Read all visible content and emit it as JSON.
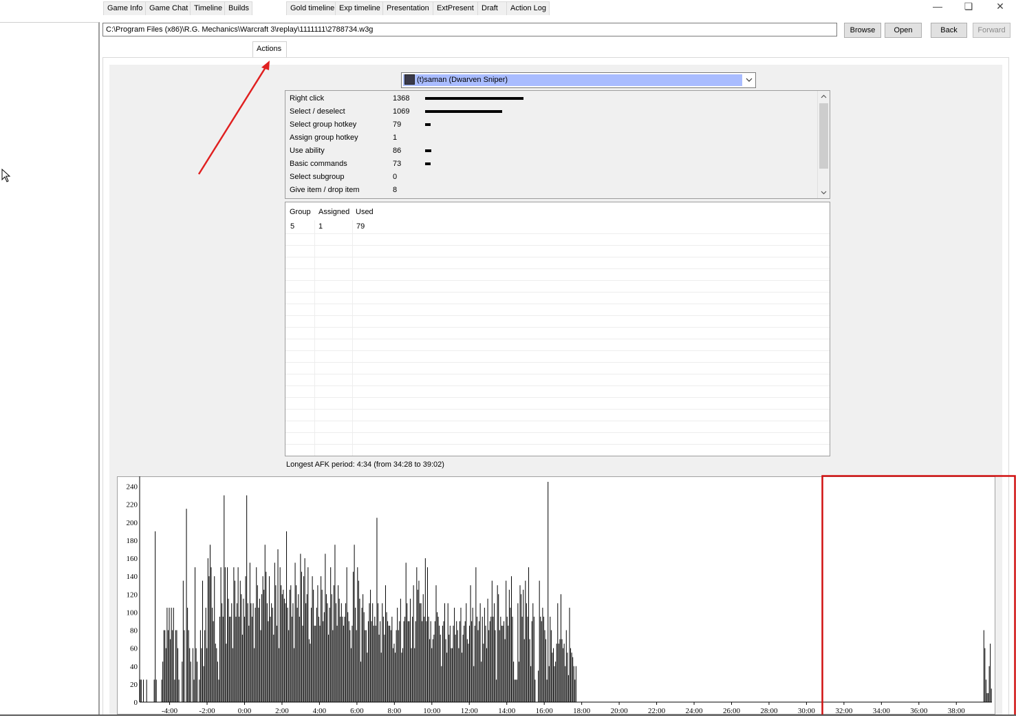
{
  "window": {
    "controls": [
      "minimize",
      "restore",
      "close"
    ]
  },
  "toolbar": {
    "path_value": "C:\\Program Files (x86)\\R.G. Mechanics\\Warcraft 3\\replay\\1111111\\2788734.w3g",
    "browse_label": "Browse",
    "open_label": "Open",
    "back_label": "Back",
    "forward_label": "Forward"
  },
  "tabs": [
    {
      "label": "Game Info"
    },
    {
      "label": "Game Chat"
    },
    {
      "label": "Timeline"
    },
    {
      "label": "Builds"
    },
    {
      "label": "Actions",
      "active": true
    },
    {
      "label": "Gold timeline"
    },
    {
      "label": "Exp timeline"
    },
    {
      "label": "Presentation"
    },
    {
      "label": "ExtPresent"
    },
    {
      "label": "Draft"
    },
    {
      "label": "Action Log"
    }
  ],
  "player_select": {
    "selected": "(t)saman (Dwarven Sniper)"
  },
  "actions": [
    {
      "name": "Right click",
      "count": 1368
    },
    {
      "name": "Select / deselect",
      "count": 1069
    },
    {
      "name": "Select group hotkey",
      "count": 79
    },
    {
      "name": "Assign group hotkey",
      "count": 1
    },
    {
      "name": "Use ability",
      "count": 86
    },
    {
      "name": "Basic commands",
      "count": 73
    },
    {
      "name": "Select subgroup",
      "count": 0
    },
    {
      "name": "Give item / drop item",
      "count": 8
    }
  ],
  "groups": {
    "headers": [
      "Group",
      "Assigned",
      "Used"
    ],
    "rows": [
      [
        "5",
        "1",
        "79"
      ]
    ]
  },
  "afk": {
    "text": "Longest AFK period: 4:34 (from 34:28 to 39:02)"
  },
  "chart_data": {
    "type": "bar",
    "title": "",
    "xlabel": "",
    "ylabel": "",
    "ylim": [
      0,
      245
    ],
    "yticks": [
      0,
      20,
      40,
      60,
      80,
      100,
      120,
      140,
      160,
      180,
      200,
      220,
      240
    ],
    "xticks": [
      "-4:00",
      "-2:00",
      "0:00",
      "2:00",
      "4:00",
      "6:00",
      "8:00",
      "10:00",
      "12:00",
      "14:00",
      "16:00",
      "18:00",
      "20:00",
      "22:00",
      "24:00",
      "26:00",
      "28:00",
      "30:00",
      "32:00",
      "34:00",
      "36:00",
      "38:00"
    ],
    "x_range_minutes": [
      -5.6,
      39.9
    ],
    "bar_color": "#000000",
    "series": [
      {
        "values": [
          25,
          25,
          0,
          25,
          0,
          0,
          25,
          0,
          0,
          0,
          0,
          0,
          0,
          25,
          190,
          25,
          0,
          0,
          0,
          0,
          25,
          45,
          80,
          80,
          60,
          105,
          80,
          105,
          70,
          105,
          80,
          105,
          25,
          80,
          80,
          60,
          25,
          0,
          0,
          45,
          135,
          80,
          0,
          215,
          105,
          80,
          60,
          45,
          0,
          60,
          25,
          150,
          60,
          45,
          0,
          25,
          80,
          60,
          135,
          40,
          80,
          105,
          60,
          160,
          140,
          175,
          150,
          105,
          90,
          140,
          65,
          60,
          45,
          25,
          95,
          150,
          110,
          95,
          230,
          150,
          65,
          150,
          115,
          95,
          95,
          110,
          60,
          150,
          135,
          95,
          110,
          150,
          95,
          135,
          120,
          75,
          115,
          95,
          140,
          230,
          110,
          85,
          155,
          110,
          95,
          110,
          60,
          105,
          150,
          130,
          105,
          115,
          80,
          120,
          140,
          125,
          175,
          145,
          110,
          90,
          140,
          95,
          110,
          105,
          75,
          155,
          130,
          85,
          170,
          60,
          150,
          130,
          120,
          125,
          115,
          110,
          190,
          105,
          80,
          125,
          130,
          95,
          110,
          60,
          155,
          130,
          105,
          120,
          95,
          165,
          145,
          85,
          140,
          160,
          110,
          120,
          150,
          70,
          65,
          105,
          140,
          125,
          85,
          85,
          105,
          130,
          95,
          85,
          140,
          125,
          90,
          100,
          165,
          120,
          110,
          75,
          105,
          150,
          120,
          80,
          130,
          175,
          110,
          85,
          130,
          115,
          95,
          110,
          95,
          85,
          95,
          110,
          150,
          100,
          90,
          80,
          60,
          85,
          145,
          175,
          105,
          80,
          150,
          135,
          115,
          45,
          105,
          120,
          100,
          80,
          80,
          55,
          90,
          110,
          125,
          90,
          110,
          85,
          95,
          85,
          205,
          110,
          75,
          90,
          55,
          110,
          95,
          75,
          130,
          100,
          90,
          85,
          85,
          80,
          95,
          60,
          65,
          55,
          80,
          105,
          80,
          90,
          115,
          55,
          60,
          90,
          95,
          155,
          110,
          90,
          90,
          115,
          60,
          95,
          130,
          60,
          90,
          150,
          125,
          135,
          110,
          110,
          90,
          120,
          95,
          160,
          90,
          150,
          95,
          70,
          90,
          60,
          70,
          75,
          90,
          130,
          100,
          95,
          85,
          75,
          40,
          85,
          90,
          110,
          70,
          55,
          110,
          75,
          85,
          60,
          60,
          85,
          105,
          75,
          90,
          80,
          60,
          90,
          105,
          55,
          75,
          85,
          90,
          110,
          70,
          65,
          85,
          130,
          90,
          105,
          40,
          85,
          150,
          95,
          80,
          90,
          110,
          45,
          95,
          65,
          105,
          85,
          60,
          115,
          80,
          90,
          95,
          135,
          95,
          110,
          80,
          25,
          130,
          120,
          80,
          95,
          85,
          85,
          90,
          70,
          135,
          95,
          85,
          125,
          105,
          140,
          95,
          45,
          25,
          25,
          25,
          110,
          45,
          130,
          120,
          95,
          125,
          70,
          135,
          110,
          95,
          150,
          70,
          40,
          90,
          110,
          95,
          25,
          0,
          0,
          35,
          135,
          95,
          90,
          105,
          95,
          80,
          70,
          25,
          245,
          40,
          95,
          80,
          55,
          60,
          40,
          45,
          65,
          110,
          65,
          70,
          120,
          70,
          60,
          65,
          40,
          80,
          55,
          30,
          105,
          60,
          55,
          50,
          40,
          25,
          40,
          0,
          0,
          0,
          0,
          0,
          0,
          0,
          0,
          0,
          0,
          0,
          0,
          0,
          0,
          0,
          0,
          0,
          0,
          0,
          0,
          0,
          0,
          0,
          0,
          0,
          0,
          0,
          0,
          0,
          0,
          0,
          0,
          0,
          0,
          0,
          0,
          0,
          0,
          0,
          0,
          0,
          0,
          0,
          0,
          0,
          0,
          0,
          0,
          0,
          0,
          0,
          0,
          0,
          0,
          0,
          0,
          0,
          0,
          0,
          0,
          0,
          0,
          0,
          0,
          0,
          0,
          0,
          0,
          0,
          0,
          0,
          0,
          0,
          0,
          0,
          0,
          0,
          0,
          0,
          0,
          0,
          0,
          0,
          0,
          0,
          0,
          0,
          0,
          0,
          0,
          0,
          0,
          0,
          0,
          0,
          0,
          0,
          0,
          0,
          0,
          0,
          0,
          0,
          0,
          0,
          0,
          0,
          0,
          0,
          0,
          0,
          0,
          0,
          0,
          0,
          0,
          0,
          0,
          0,
          0,
          0,
          0,
          0,
          0,
          0,
          0,
          0,
          0,
          0,
          0,
          0,
          0,
          0,
          0,
          0,
          0,
          0,
          0,
          0,
          0,
          0,
          0,
          0,
          0,
          0,
          0,
          0,
          0,
          0,
          0,
          0,
          0,
          0,
          0,
          0,
          0,
          0,
          0,
          0,
          0,
          0,
          0,
          0,
          0,
          0,
          0,
          0,
          0,
          0,
          0,
          0,
          0,
          0,
          0,
          0,
          0,
          0,
          0,
          0,
          0,
          0,
          0,
          0,
          0,
          0,
          0,
          0,
          0,
          0,
          0,
          0,
          0,
          0,
          0,
          0,
          0,
          0,
          0,
          0,
          0,
          0,
          0,
          0,
          0,
          0,
          0,
          0,
          0,
          0,
          0,
          0,
          0,
          0,
          0,
          0,
          0,
          0,
          0,
          0,
          0,
          0,
          0,
          0,
          0,
          0,
          0,
          0,
          0,
          0,
          0,
          0,
          0,
          0,
          0,
          0,
          0,
          0,
          0,
          0,
          0,
          0,
          0,
          0,
          0,
          0,
          0,
          0,
          0,
          0,
          0,
          0,
          0,
          0,
          0,
          0,
          0,
          0,
          0,
          0,
          0,
          0,
          0,
          0,
          0,
          0,
          0,
          0,
          0,
          0,
          0,
          0,
          0,
          0,
          0,
          0,
          0,
          0,
          0,
          0,
          0,
          0,
          0,
          0,
          0,
          0,
          0,
          0,
          0,
          0,
          0,
          0,
          0,
          0,
          0,
          0,
          0,
          0,
          0,
          0,
          0,
          0,
          0,
          0,
          0,
          0,
          0,
          0,
          0,
          0,
          0,
          0,
          0,
          0,
          0,
          0,
          0,
          0,
          0,
          0,
          0,
          0,
          0,
          0,
          0,
          0,
          0,
          0,
          0,
          0,
          0,
          0,
          0,
          0,
          0,
          0,
          0,
          0,
          0,
          0,
          0,
          0,
          0,
          0,
          0,
          0,
          0,
          0,
          0,
          0,
          0,
          0,
          0,
          0,
          0,
          0,
          0,
          0,
          0,
          0,
          0,
          0,
          0,
          0,
          0,
          0,
          0,
          0,
          0,
          0,
          0,
          0,
          0,
          0,
          0,
          0,
          0,
          0,
          0,
          80,
          60,
          25,
          10,
          10,
          40,
          65,
          15
        ]
      }
    ]
  },
  "annotations": {
    "arrow_color": "#e02020",
    "highlight_box_color": "#d01010"
  }
}
